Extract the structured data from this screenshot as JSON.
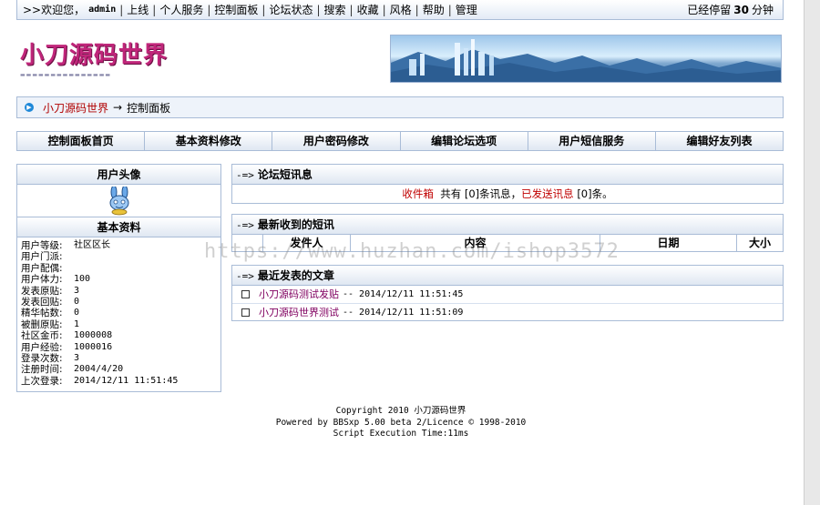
{
  "topbar": {
    "welcome_prefix": ">>欢迎您，",
    "username": "admin",
    "links": [
      "上线",
      "个人服务",
      "控制面板",
      "论坛状态",
      "搜索",
      "收藏",
      "风格",
      "帮助",
      "管理"
    ],
    "stay_prefix": "已经停留",
    "stay_minutes": "30",
    "stay_suffix": "分钟"
  },
  "logo": {
    "title": "小刀源码世界"
  },
  "breadcrumb": {
    "home": "小刀源码世界",
    "arrow": "→",
    "current": "控制面板"
  },
  "nav": {
    "items": [
      "控制面板首页",
      "基本资料修改",
      "用户密码修改",
      "编辑论坛选项",
      "用户短信服务",
      "编辑好友列表"
    ]
  },
  "profile": {
    "avatar_title": "用户头像",
    "info_title": "基本资料",
    "rows": [
      {
        "k": "用户等级:",
        "v": "社区区长"
      },
      {
        "k": "用户门派:",
        "v": ""
      },
      {
        "k": "用户配偶:",
        "v": ""
      },
      {
        "k": "用户体力:",
        "v": "100"
      },
      {
        "k": "发表原贴:",
        "v": "3"
      },
      {
        "k": "发表回贴:",
        "v": "0"
      },
      {
        "k": "精华帖数:",
        "v": "0"
      },
      {
        "k": "被删原贴:",
        "v": "1"
      },
      {
        "k": "社区金币:",
        "v": "1000008"
      },
      {
        "k": "用户经验:",
        "v": "1000016"
      },
      {
        "k": "登录次数:",
        "v": "3"
      },
      {
        "k": "注册时间:",
        "v": "2004/4/20"
      },
      {
        "k": "上次登录:",
        "v": "2014/12/11 11:51:45"
      }
    ]
  },
  "sms": {
    "arrow": "-=>",
    "title": "论坛短讯息",
    "inbox_label": "收件箱",
    "total_text": "共有",
    "inbox_count": "[0]",
    "inbox_suffix": "条讯息，",
    "sent_label": "已发送讯息",
    "sent_count": "[0]",
    "sent_suffix": "条。"
  },
  "latest_msgs": {
    "arrow": "-=>",
    "title": "最新收到的短讯",
    "columns": [
      "",
      "发件人",
      "内容",
      "日期",
      "大小"
    ]
  },
  "recent_posts": {
    "arrow": "-=>",
    "title": "最近发表的文章",
    "items": [
      {
        "title": "小刀源码测试发贴",
        "time": "-- 2014/12/11 11:51:45"
      },
      {
        "title": "小刀源码世界测试",
        "time": "-- 2014/12/11 11:51:09"
      }
    ]
  },
  "footer": {
    "copyright": "Copyright 2010 小刀源码世界",
    "powered": "Powered by BBSxp 5.00 beta 2/Licence © 1998-2010",
    "exec": "Script Execution Time:11ms"
  },
  "watermark": "https://www.huzhan.com/ishop3572"
}
